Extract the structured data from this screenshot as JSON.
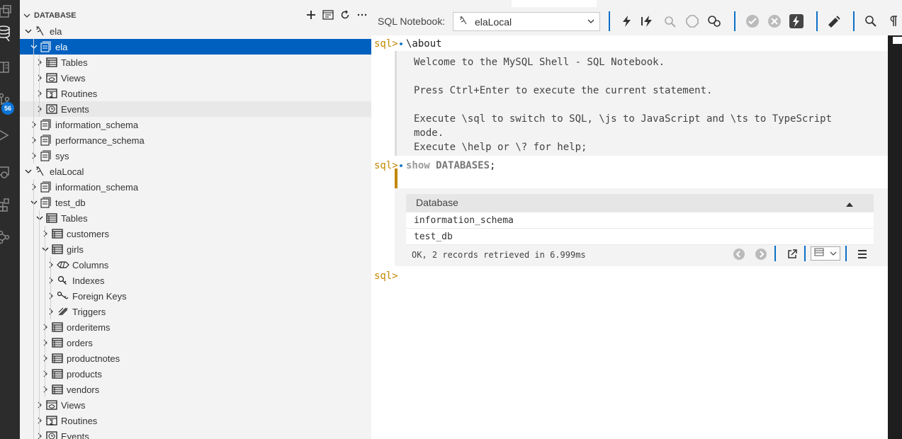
{
  "activity_bar": {
    "icons": [
      "explorer-icon",
      "database-icon",
      "book-icon",
      "source-control-icon",
      "run-debug-icon",
      "remote-icon",
      "extensions-icon",
      "connections-icon"
    ],
    "badge": "56"
  },
  "sidebar": {
    "section_title": "DATABASE",
    "actions": [
      "add-icon",
      "new-notebook-icon",
      "refresh-icon",
      "more-icon"
    ],
    "tree": [
      {
        "label": "ela",
        "level": 1,
        "expanded": true,
        "icon": "connection-icon",
        "state": ""
      },
      {
        "label": "ela",
        "level": 2,
        "expanded": true,
        "icon": "schema-icon",
        "state": "selected"
      },
      {
        "label": "Tables",
        "level": 3,
        "expanded": false,
        "icon": "table-icon",
        "state": ""
      },
      {
        "label": "Views",
        "level": 3,
        "expanded": false,
        "icon": "view-icon",
        "state": ""
      },
      {
        "label": "Routines",
        "level": 3,
        "expanded": false,
        "icon": "routine-icon",
        "state": ""
      },
      {
        "label": "Events",
        "level": 3,
        "expanded": false,
        "icon": "event-icon",
        "state": "hover"
      },
      {
        "label": "information_schema",
        "level": 2,
        "expanded": false,
        "icon": "schema-icon",
        "state": ""
      },
      {
        "label": "performance_schema",
        "level": 2,
        "expanded": false,
        "icon": "schema-icon",
        "state": ""
      },
      {
        "label": "sys",
        "level": 2,
        "expanded": false,
        "icon": "schema-icon",
        "state": ""
      },
      {
        "label": "elaLocal",
        "level": 1,
        "expanded": true,
        "icon": "connection-icon",
        "state": ""
      },
      {
        "label": "information_schema",
        "level": 2,
        "expanded": false,
        "icon": "schema-icon",
        "state": ""
      },
      {
        "label": "test_db",
        "level": 2,
        "expanded": true,
        "icon": "schema-icon",
        "state": ""
      },
      {
        "label": "Tables",
        "level": 3,
        "expanded": true,
        "icon": "table-icon",
        "state": ""
      },
      {
        "label": "customers",
        "level": 4,
        "expanded": false,
        "icon": "table-icon",
        "state": ""
      },
      {
        "label": "girls",
        "level": 4,
        "expanded": true,
        "icon": "table-icon",
        "state": ""
      },
      {
        "label": "Columns",
        "level": 5,
        "expanded": false,
        "icon": "columns-icon",
        "state": ""
      },
      {
        "label": "Indexes",
        "level": 5,
        "expanded": false,
        "icon": "indexes-icon",
        "state": ""
      },
      {
        "label": "Foreign Keys",
        "level": 5,
        "expanded": false,
        "icon": "foreign-keys-icon",
        "state": ""
      },
      {
        "label": "Triggers",
        "level": 5,
        "expanded": false,
        "icon": "triggers-icon",
        "state": ""
      },
      {
        "label": "orderitems",
        "level": 4,
        "expanded": false,
        "icon": "table-icon",
        "state": ""
      },
      {
        "label": "orders",
        "level": 4,
        "expanded": false,
        "icon": "table-icon",
        "state": ""
      },
      {
        "label": "productnotes",
        "level": 4,
        "expanded": false,
        "icon": "table-icon",
        "state": ""
      },
      {
        "label": "products",
        "level": 4,
        "expanded": false,
        "icon": "table-icon",
        "state": ""
      },
      {
        "label": "vendors",
        "level": 4,
        "expanded": false,
        "icon": "table-icon",
        "state": ""
      },
      {
        "label": "Views",
        "level": 3,
        "expanded": false,
        "icon": "view-icon",
        "state": ""
      },
      {
        "label": "Routines",
        "level": 3,
        "expanded": false,
        "icon": "routine-icon",
        "state": ""
      },
      {
        "label": "Events",
        "level": 3,
        "expanded": false,
        "icon": "event-icon",
        "state": ""
      }
    ]
  },
  "toolbar": {
    "notebook_label": "SQL Notebook:",
    "connection": "elaLocal"
  },
  "editor": {
    "prompt": "sql>",
    "cmd1": "\\about",
    "output": [
      "Welcome to the MySQL Shell - SQL Notebook.",
      "",
      "Press Ctrl+Enter to execute the current statement.",
      "",
      "Execute \\sql to switch to SQL, \\js to JavaScript and \\ts to TypeScript",
      "mode.",
      "Execute \\help or \\? for help;"
    ],
    "cmd2_kw1": "show",
    "cmd2_kw2": "DATABASES",
    "cmd2_end": ";",
    "result": {
      "column": "Database",
      "rows": [
        "information_schema",
        "test_db"
      ],
      "status": "OK, 2 records retrieved in 6.999ms"
    },
    "prompt3": "sql>"
  }
}
